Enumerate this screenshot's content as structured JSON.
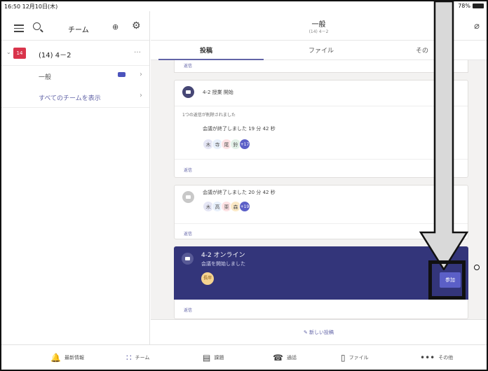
{
  "status_bar": {
    "time": "16:50  12月10日(木)",
    "battery": "78%"
  },
  "sidebar": {
    "title": "チーム",
    "team": {
      "badge": "14",
      "name": "(14) 4－2"
    },
    "channels": [
      {
        "label": "一般"
      }
    ],
    "all_teams_label": "すべてのチームを表示"
  },
  "header": {
    "channel_title": "一般",
    "channel_sub": "(14) 4－2"
  },
  "tabs": [
    {
      "label": "投稿"
    },
    {
      "label": "ファイル"
    },
    {
      "label": "その"
    }
  ],
  "feed": {
    "reply_label": "返信",
    "card1": {
      "title": "4-2 授業 開始"
    },
    "card2": {
      "deleted_note": "1つの返信が削除されました",
      "ended": "会議が終了しました 19 分 42 秒",
      "avatars": [
        "木",
        "寺",
        "尾",
        "鈴"
      ],
      "more": "+17"
    },
    "card3": {
      "ended": "会議が終了しました 20 分 42 秒",
      "avatars": [
        "木",
        "高",
        "栗",
        "森"
      ],
      "more": "+19"
    },
    "live": {
      "title": "4-2  オンライン",
      "subtitle": "会議を開始しました",
      "avatar": "長岸",
      "join": "参加"
    },
    "new_post": "新しい投稿"
  },
  "bottom_nav": [
    {
      "label": "最新情報",
      "icon": "bell-icon"
    },
    {
      "label": "チーム",
      "icon": "teams-icon"
    },
    {
      "label": "課題",
      "icon": "assignment-icon"
    },
    {
      "label": "通話",
      "icon": "phone-icon"
    },
    {
      "label": "ファイル",
      "icon": "file-icon"
    },
    {
      "label": "その他",
      "icon": "more-icon"
    }
  ],
  "colors": {
    "accent": "#6264a7",
    "live_card": "#33357a",
    "team_badge": "#d9344b"
  }
}
